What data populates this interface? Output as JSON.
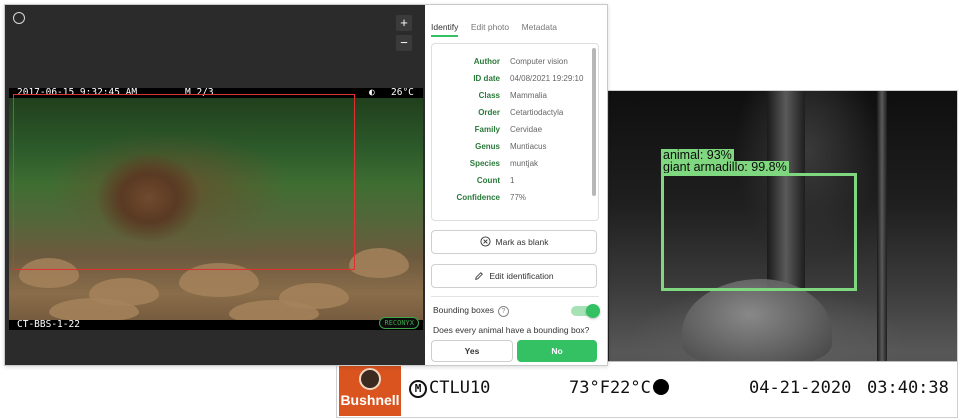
{
  "back_photo": {
    "detections": [
      {
        "label": "animal: 93%"
      },
      {
        "label": "giant armadillo: 99.8%"
      }
    ],
    "footer": {
      "brand": "Bushnell",
      "camera_id": "CTLU10",
      "temperature": "73°F22°C",
      "date": "04-21-2020",
      "time": "03:40:38"
    }
  },
  "viewer": {
    "zoom_in": "+",
    "zoom_out": "−",
    "overlay": {
      "timestamp": "2017-06-15 9:32:45 AM",
      "mode": "M 2/3",
      "temperature": "26°C",
      "moon_icon": "◐",
      "station": "CT-BBS-1-22",
      "brand": "RECONYX"
    }
  },
  "panel": {
    "tabs": [
      {
        "label": "Identify",
        "active": true
      },
      {
        "label": "Edit photo",
        "active": false
      },
      {
        "label": "Metadata",
        "active": false
      }
    ],
    "info": [
      {
        "key": "Author",
        "value": "Computer vision"
      },
      {
        "key": "ID date",
        "value": "04/08/2021 19:29:10"
      },
      {
        "key": "Class",
        "value": "Mammalia"
      },
      {
        "key": "Order",
        "value": "Cetartiodactyla"
      },
      {
        "key": "Family",
        "value": "Cervidae"
      },
      {
        "key": "Genus",
        "value": "Muntiacus"
      },
      {
        "key": "Species",
        "value": "muntjak"
      },
      {
        "key": "Count",
        "value": "1"
      },
      {
        "key": "Confidence",
        "value": "77%"
      }
    ],
    "mark_blank_label": "Mark as blank",
    "edit_identification_label": "Edit identification",
    "bounding_boxes_label": "Bounding boxes",
    "bounding_boxes_on": true,
    "question": "Does every animal have a bounding box?",
    "yes_label": "Yes",
    "no_label": "No"
  },
  "colors": {
    "accent_green": "#34c164",
    "label_green": "#2a7a3a",
    "detection_box": "#7fd77f",
    "red_box": "#e03131",
    "bushnell_orange": "#d9541f"
  }
}
